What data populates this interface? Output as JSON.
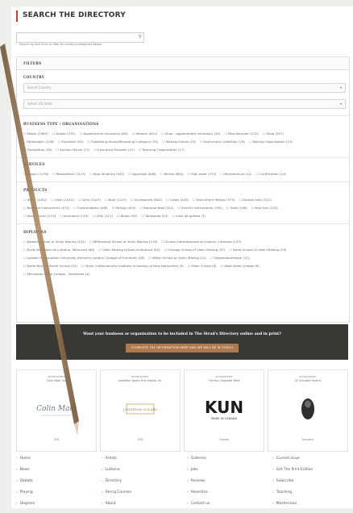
{
  "directory": {
    "title": "SEARCH THE DIRECTORY",
    "search_placeholder": "Search by text here or filter by country/categories below"
  },
  "filters": {
    "label": "FILTERS",
    "country": {
      "label": "COUNTRY",
      "country_select": "Select Country",
      "state_select": "Select US State"
    },
    "business_type": {
      "label": "BUSINESS TYPE / ORGANISATIONS",
      "row1": [
        "Maker (1462)",
        "Dealer (332)",
        "Appointment necessary (69)",
        "Retailer (612)",
        "Shop - appointment necessary (43)",
        "Manufacturer (222)",
        "Shop (207)"
      ],
      "row2": [
        "Wholesaler (226)",
        "Publisher (92)",
        "Publishing House/Recording Company (35)",
        "Making School (22)",
        "Instrument Collection (29)",
        "Making Organisation (13)"
      ],
      "row3": [
        "Foundation (20)",
        "Auction House (17)",
        "Insurance Provider (17)",
        "Teaching Organisation (17)"
      ]
    },
    "services": {
      "label": "SERVICES",
      "row1": [
        "Repair (1276)",
        "Restoration (1123)",
        "Bow rehairing (942)",
        "Appraisal (646)",
        "Rental (604)",
        "Mail order (375)",
        "Maintenance (11)",
        "Certification (14)"
      ]
    },
    "products": {
      "label": "PRODUCTS",
      "row1": [
        "Violin (1452)",
        "Viola (1441)",
        "Cello (1423)",
        "Bow (1123)",
        "Accessories (802)",
        "Cases (403)",
        "Instrument fittings (374)",
        "Double bass (321)"
      ],
      "row2": [
        "Baroque instruments (472)",
        "Consumables (408)",
        "Strings (403)",
        "Baroque bow (322)",
        "Electric instruments (192)",
        "Tools (146)",
        "Bow hair (132)"
      ],
      "row3": [
        "Sheet music (113)",
        "Insurance (114)",
        "Gifts (111)",
        "Books (92)",
        "Tonewood (54)",
        "viola da gamba (3)"
      ]
    },
    "diplomas": {
      "label": "DIPLOMAS",
      "row1": [
        "Newark School of Violin Making (141)",
        "Mittenwald School of Violin Making (119)",
        "Scuola Internazionale di Liuteria, Cremona (133)"
      ],
      "row2": [
        "École Nationale de Lutherie, Mirecourt (68)",
        "Violin Making School of America (42)",
        "Chicago School of Violin Making (37)",
        "Swiss School of Violin Making (29)"
      ],
      "row3": [
        "London Metropolitan University (formerly London College of Furniture) (28)",
        "Welsh School of Violin Making (22)",
        "Geigenbauerester (21)"
      ],
      "row4": [
        "North Bennet Street School (12)",
        "Violin Craftsmanship Institute University of New Hampshire (9)",
        "Milan School (8)",
        "West Dean College (6)"
      ],
      "row5": [
        "Minnesota State College - Southeast (4)"
      ]
    }
  },
  "banner": {
    "question": "Want your business or organisation to be included in The Strad's Directory online and in print?",
    "button": "COMPLETE THE INFORMATION HERE AND WE WILL BE IN TOUCH"
  },
  "sponsors": [
    {
      "label": "SPONSORED",
      "name": "Colin Maki, Inc",
      "logo_text": "Colin Maki",
      "footer": "USA"
    },
    {
      "label": "SPONSORED",
      "name": "Jonathan Solars Fine Violins, Inc",
      "logo_text": "JONATHAN SOLARS",
      "footer": "USA"
    },
    {
      "label": "SPONSORED",
      "name": "The Kun Shoulder Rest",
      "logo_text": "KUN",
      "logo_sub": "MADE IN CANADA",
      "footer": "Canada"
    },
    {
      "label": "SPONSORED",
      "name": "CF Schuster Violins",
      "logo_text": "",
      "footer": "Germany"
    }
  ],
  "footer": {
    "col1": [
      "Home",
      "News",
      "Debate",
      "Playing",
      "Degrees"
    ],
    "col2": [
      "Artists",
      "Lutherie",
      "Directory",
      "String Courses",
      "About"
    ],
    "col3": [
      "Galleries",
      "Jobs",
      "Reviews",
      "Advertise",
      "Contact us"
    ],
    "col4": [
      "Current Issue",
      "Get The Print Edition",
      "Subscribe",
      "Teaching",
      "Masterclass"
    ]
  },
  "colors": {
    "accent": "#b44a2b",
    "banner_bg": "#3a3835",
    "button_bg": "#b07a4f",
    "pen": "#8a6a4a"
  },
  "icons": {
    "search": "search-icon",
    "dropdown": "chevron-down-icon"
  }
}
